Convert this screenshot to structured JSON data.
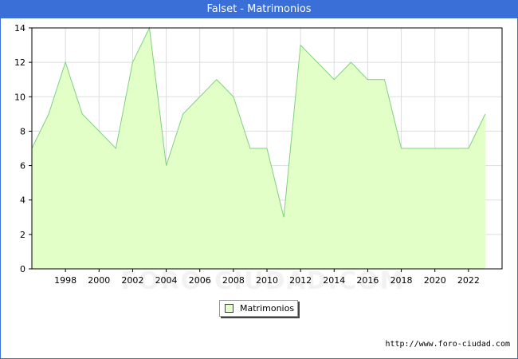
{
  "title": "Falset - Matrimonios",
  "watermark": "FORO-CIUDAD.COM",
  "source": "http://www.foro-ciudad.com",
  "colors": {
    "title_bar": "#3a6fd8",
    "area_fill": "#e2ffc8",
    "line": "#7fd07f",
    "grid": "#dddddd"
  },
  "chart_data": {
    "type": "area",
    "title": "Falset - Matrimonios",
    "x": [
      1996,
      1997,
      1998,
      1999,
      2000,
      2001,
      2002,
      2003,
      2004,
      2005,
      2006,
      2007,
      2008,
      2009,
      2010,
      2011,
      2012,
      2013,
      2014,
      2015,
      2016,
      2017,
      2018,
      2019,
      2020,
      2021,
      2022,
      2023
    ],
    "series": [
      {
        "name": "Matrimonios",
        "values": [
          7,
          9,
          12,
          9,
          8,
          7,
          12,
          14,
          6,
          9,
          10,
          11,
          10,
          7,
          7,
          3,
          13,
          12,
          11,
          12,
          11,
          11,
          7,
          7,
          7,
          7,
          7,
          9
        ]
      }
    ],
    "xlim": [
      1996,
      2024
    ],
    "ylim": [
      0,
      14
    ],
    "x_ticks": [
      "1998",
      "2000",
      "2002",
      "2004",
      "2006",
      "2008",
      "2010",
      "2012",
      "2014",
      "2016",
      "2018",
      "2020",
      "2022"
    ],
    "y_ticks": [
      "0",
      "2",
      "4",
      "6",
      "8",
      "10",
      "12",
      "14"
    ],
    "grid": true,
    "legend_position": "bottom-center"
  }
}
